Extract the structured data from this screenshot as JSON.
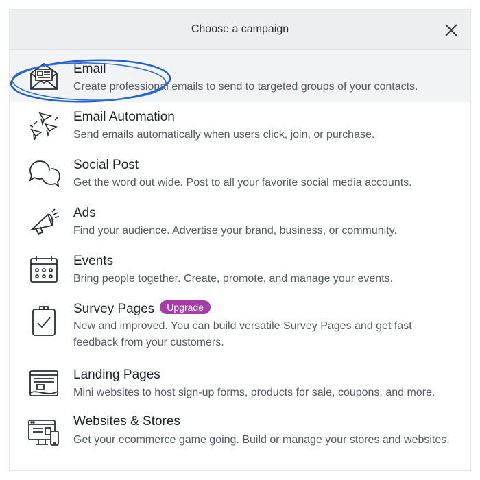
{
  "header": {
    "title": "Choose a campaign"
  },
  "campaigns": [
    {
      "icon": "email-envelope-icon",
      "title": "Email",
      "desc": "Create professional emails to send to targeted groups of your contacts."
    },
    {
      "icon": "paper-planes-icon",
      "title": "Email Automation",
      "desc": "Send emails automatically when users click, join, or purchase."
    },
    {
      "icon": "speech-bubbles-icon",
      "title": "Social Post",
      "desc": "Get the word out wide. Post to all your favorite social media accounts."
    },
    {
      "icon": "megaphone-icon",
      "title": "Ads",
      "desc": "Find your audience. Advertise your brand, business, or community."
    },
    {
      "icon": "calendar-icon",
      "title": "Events",
      "desc": "Bring people together. Create, promote, and manage your events."
    },
    {
      "icon": "clipboard-check-icon",
      "title": "Survey Pages",
      "badge": "Upgrade",
      "desc": "New and improved. You can build versatile Survey Pages and get fast feedback from your customers."
    },
    {
      "icon": "landing-page-icon",
      "title": "Landing Pages",
      "desc": "Mini websites to host sign-up forms, products for sale, coupons, and more."
    },
    {
      "icon": "desktop-mobile-icon",
      "title": "Websites & Stores",
      "desc": "Get your ecommerce game going. Build or manage your stores and websites."
    }
  ],
  "colors": {
    "highlight_circle": "#1f5fc9",
    "badge": "#a53ca8",
    "selected_row": "#f2f3f4"
  }
}
